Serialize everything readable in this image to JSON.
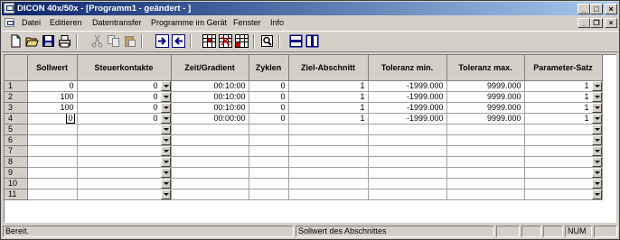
{
  "window": {
    "title": "DICON 40x/50x - [Programm1 - geändert - ]"
  },
  "caption_buttons": {
    "minimize": "_",
    "maximize": "□",
    "close": "×"
  },
  "menu": {
    "items": [
      "Datei",
      "Editieren",
      "Datentransfer",
      "Programme im Gerät",
      "Fenster",
      "Info"
    ],
    "mdi_buttons": {
      "minimize": "_",
      "restore": "❐",
      "close": "×"
    }
  },
  "toolbar": {
    "buttons": [
      {
        "name": "new-document-icon"
      },
      {
        "name": "open-folder-icon"
      },
      {
        "name": "save-icon"
      },
      {
        "name": "print-icon"
      },
      {
        "name": "cut-icon"
      },
      {
        "name": "copy-icon"
      },
      {
        "name": "paste-icon"
      },
      {
        "name": "transfer-to-device-icon"
      },
      {
        "name": "transfer-from-device-icon"
      },
      {
        "name": "insert-row-icon"
      },
      {
        "name": "delete-row-icon"
      },
      {
        "name": "table-edit-icon"
      },
      {
        "name": "find-icon"
      },
      {
        "name": "tile-horizontal-icon"
      },
      {
        "name": "tile-vertical-icon"
      }
    ]
  },
  "grid": {
    "headers": [
      "Sollwert",
      "Steuerkontakte",
      "Zeit/Gradient",
      "Zyklen",
      "Ziel-Abschnitt",
      "Toleranz min.",
      "Toleranz max.",
      "Parameter-Satz"
    ],
    "rows": [
      {
        "num": "1",
        "cells": [
          "0",
          "0",
          "00:10:00",
          "0",
          "1",
          "-1999.000",
          "9999.000",
          "1"
        ]
      },
      {
        "num": "2",
        "cells": [
          "100",
          "0",
          "00:10:00",
          "0",
          "1",
          "-1999.000",
          "9999.000",
          "1"
        ]
      },
      {
        "num": "3",
        "cells": [
          "100",
          "0",
          "00:10:00",
          "0",
          "1",
          "-1999.000",
          "9999.000",
          "1"
        ]
      },
      {
        "num": "4",
        "cells": [
          "0",
          "0",
          "00:00:00",
          "0",
          "1",
          "-1999.000",
          "9999.000",
          "1"
        ]
      },
      {
        "num": "5",
        "cells": [
          "",
          "",
          "",
          "",
          "",
          "",
          "",
          ""
        ]
      },
      {
        "num": "6",
        "cells": [
          "",
          "",
          "",
          "",
          "",
          "",
          "",
          ""
        ]
      },
      {
        "num": "7",
        "cells": [
          "",
          "",
          "",
          "",
          "",
          "",
          "",
          ""
        ]
      },
      {
        "num": "8",
        "cells": [
          "",
          "",
          "",
          "",
          "",
          "",
          "",
          ""
        ]
      },
      {
        "num": "9",
        "cells": [
          "",
          "",
          "",
          "",
          "",
          "",
          "",
          ""
        ]
      },
      {
        "num": "10",
        "cells": [
          "",
          "",
          "",
          "",
          "",
          "",
          "",
          ""
        ]
      },
      {
        "num": "11",
        "cells": [
          "",
          "",
          "",
          "",
          "",
          "",
          "",
          ""
        ]
      }
    ]
  },
  "status": {
    "left": "Bereit.",
    "hint": "Sollwert des Abschnittes",
    "num": "NUM"
  }
}
